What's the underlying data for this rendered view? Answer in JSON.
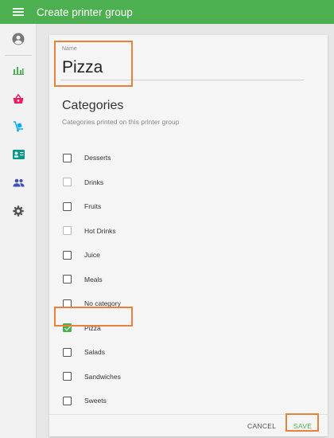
{
  "app": {
    "title": "Create printer group",
    "accent": "#4caf50",
    "highlight": "#e8823a"
  },
  "sidebar": {
    "items": [
      {
        "icon": "account-circle-icon",
        "color": "#777777"
      },
      {
        "icon": "bar-chart-icon",
        "color": "#4caf50"
      },
      {
        "icon": "shopping-basket-icon",
        "color": "#e91e63"
      },
      {
        "icon": "delivery-cart-icon",
        "color": "#03a9f4"
      },
      {
        "icon": "contact-card-icon",
        "color": "#009688"
      },
      {
        "icon": "people-icon",
        "color": "#3f51b5"
      },
      {
        "icon": "settings-gear-icon",
        "color": "#555555"
      }
    ]
  },
  "form": {
    "name_label": "Name",
    "name_value": "Pizza",
    "section_title": "Categories",
    "section_subtitle": "Categories printed on this printer group",
    "categories": [
      {
        "label": "Desserts",
        "checked": false,
        "muted": false
      },
      {
        "label": "Drinks",
        "checked": false,
        "muted": true
      },
      {
        "label": "Fruits",
        "checked": false,
        "muted": false
      },
      {
        "label": "Hot Drinks",
        "checked": false,
        "muted": true
      },
      {
        "label": "Juice",
        "checked": false,
        "muted": false
      },
      {
        "label": "Meals",
        "checked": false,
        "muted": false
      },
      {
        "label": "No category",
        "checked": false,
        "muted": false
      },
      {
        "label": "Pizza",
        "checked": true,
        "muted": false
      },
      {
        "label": "Salads",
        "checked": false,
        "muted": false
      },
      {
        "label": "Sandwiches",
        "checked": false,
        "muted": false
      },
      {
        "label": "Sweets",
        "checked": false,
        "muted": false
      }
    ],
    "cancel_label": "CANCEL",
    "save_label": "SAVE"
  }
}
